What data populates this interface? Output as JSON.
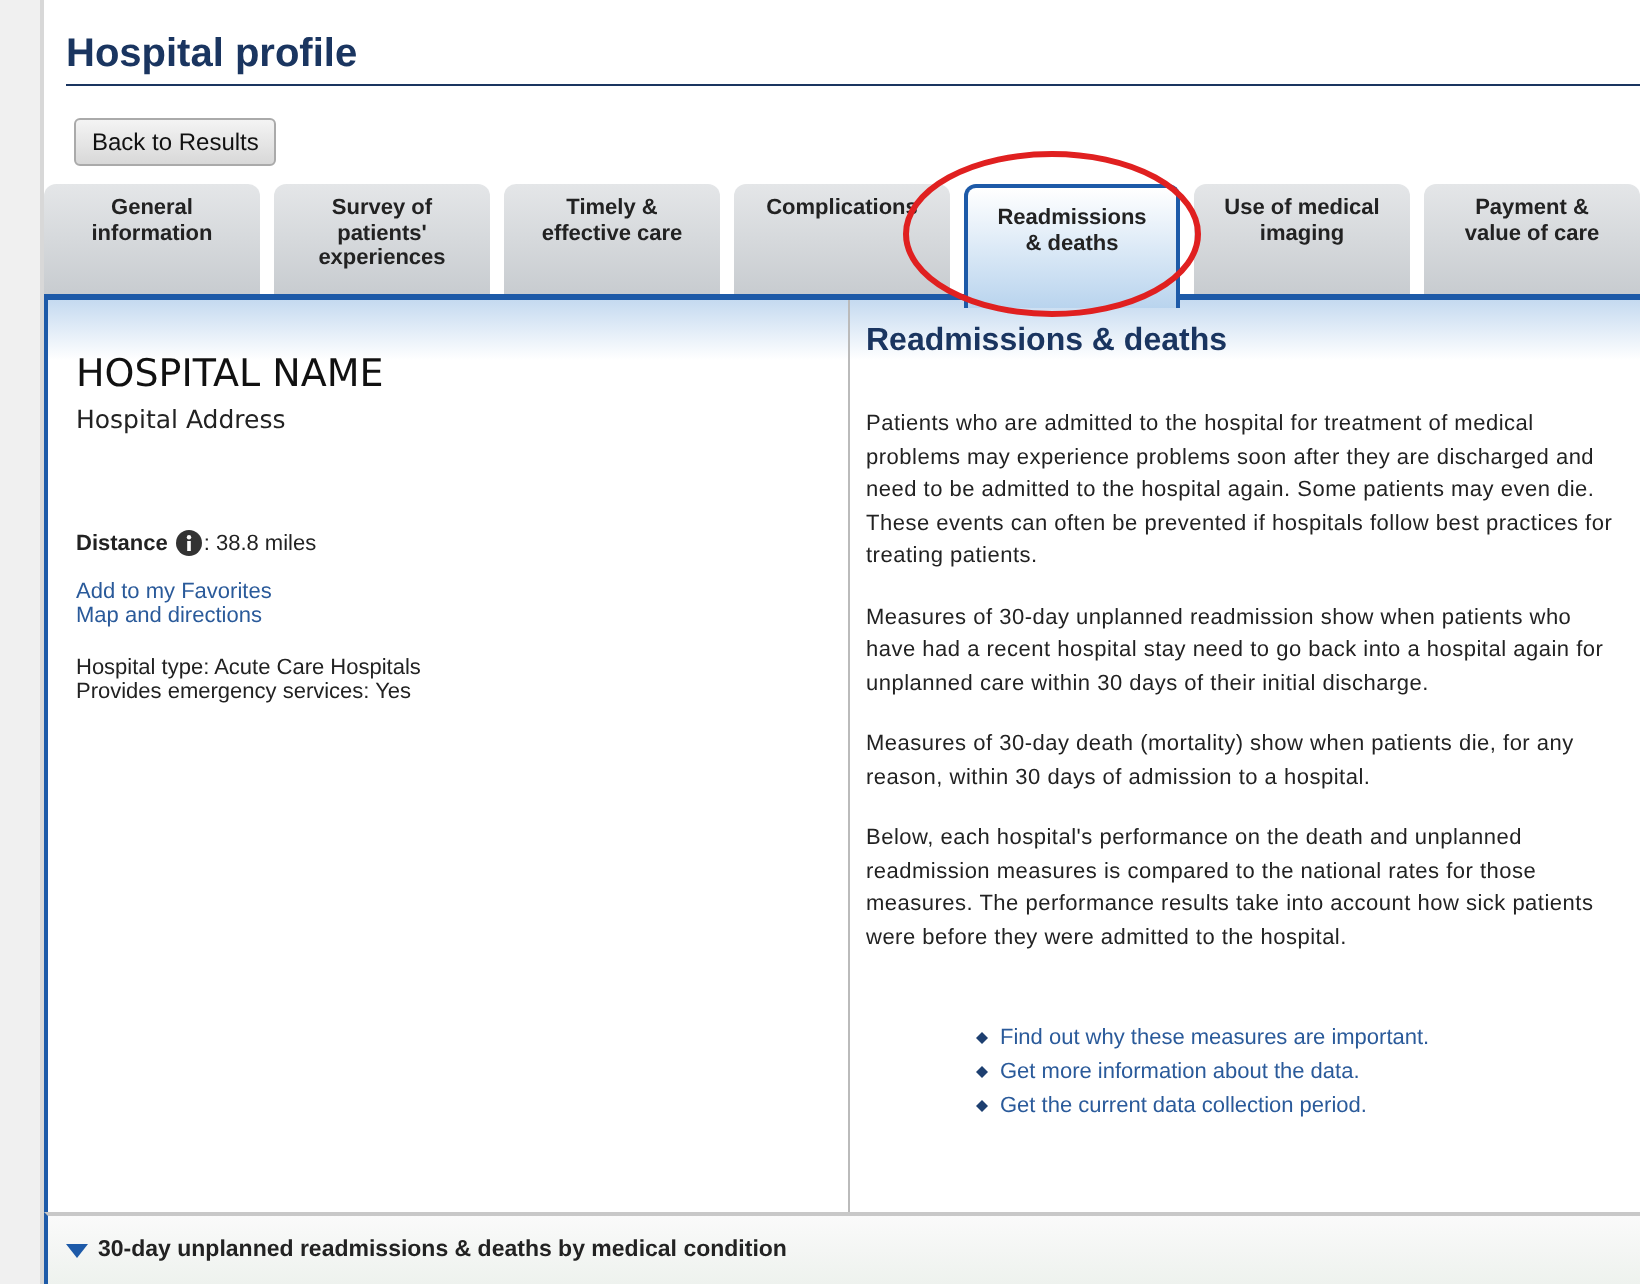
{
  "page_title": "Hospital profile",
  "back_button": "Back to Results",
  "tabs": [
    {
      "label": "General information",
      "selected": false
    },
    {
      "label": "Survey of patients' experiences",
      "selected": false
    },
    {
      "label": "Timely & effective care",
      "selected": false
    },
    {
      "label": "Complications",
      "selected": false
    },
    {
      "label": "Readmissions & deaths",
      "selected": true
    },
    {
      "label": "Use of medical imaging",
      "selected": false
    },
    {
      "label": "Payment & value of care",
      "selected": false
    }
  ],
  "hospital": {
    "name": "HOSPITAL NAME",
    "address": "Hospital Address",
    "distance_label": "Distance",
    "distance_value": ": 38.8 miles",
    "links": [
      "Add to my Favorites",
      "Map and directions"
    ],
    "details": [
      "Hospital type: Acute Care Hospitals",
      "Provides emergency services: Yes"
    ]
  },
  "section": {
    "title": "Readmissions & deaths",
    "paragraphs": [
      "Patients who are admitted to the hospital for treatment of medical problems may experience problems soon after they are discharged and need to be admitted to the hospital again. Some patients may even die. These events can often be prevented if hospitals follow best practices for treating patients.",
      "Measures of 30-day unplanned readmission show when patients who have had a recent hospital stay need to go back into a hospital again for unplanned care within 30 days of their initial discharge.",
      "Measures of 30-day death (mortality) show when patients die, for any reason, within 30 days of admission to a hospital.",
      "Below, each hospital's performance on the death and unplanned readmission measures is compared to the national rates for those measures. The performance results take into account how sick patients were before they were admitted to the hospital."
    ],
    "links": [
      "Find out why these measures are important.",
      "Get more information about the data.",
      "Get the current data collection period."
    ]
  },
  "accordion": {
    "title": "30-day unplanned readmissions & deaths by medical condition",
    "expanded": true
  }
}
